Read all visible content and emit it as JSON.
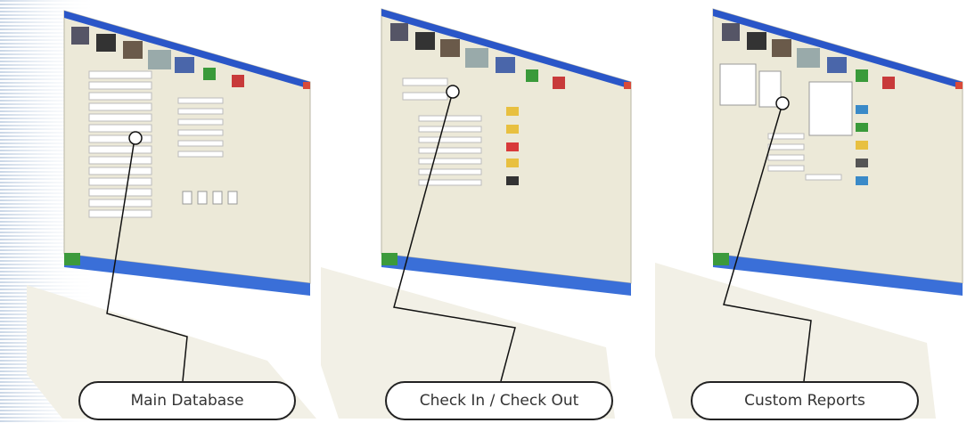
{
  "captions": {
    "main_database": "Main Database",
    "check_in_out": "Check In / Check Out",
    "custom_reports": "Custom Reports"
  },
  "colors": {
    "titlebar": "#2a56c8",
    "window_bg": "#ece9d8",
    "taskbar": "#3a6fd8",
    "start_button": "#3c9a3c",
    "close_button": "#d84a3a",
    "callout_border": "#222222"
  },
  "icons": [
    "printer-icon",
    "folder-icon",
    "people-icon",
    "tray-icon",
    "monitor-icon",
    "flag-icon",
    "exit-icon"
  ]
}
